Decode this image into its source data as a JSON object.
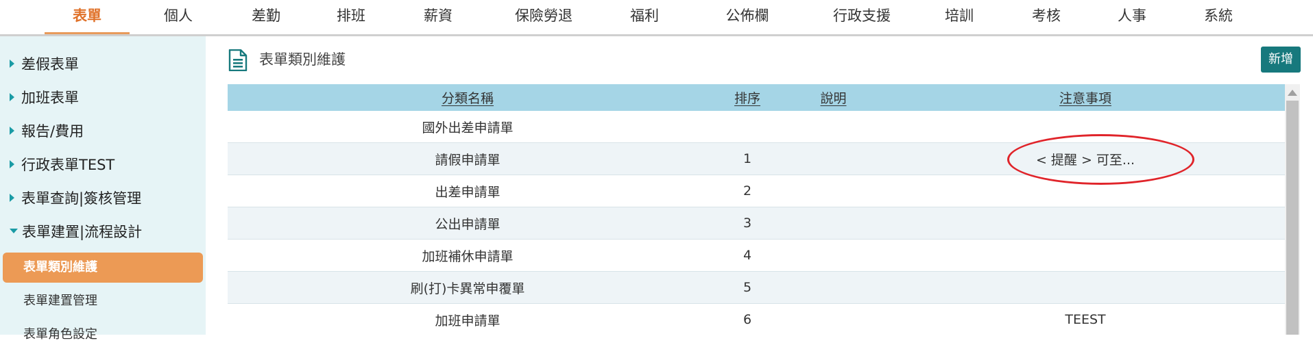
{
  "nav": {
    "items": [
      {
        "label": "表單",
        "active": true
      },
      {
        "label": "個人"
      },
      {
        "label": "差勤"
      },
      {
        "label": "排班"
      },
      {
        "label": "薪資"
      },
      {
        "label": "保險勞退"
      },
      {
        "label": "福利"
      },
      {
        "label": "公佈欄"
      },
      {
        "label": "行政支援"
      },
      {
        "label": "培訓"
      },
      {
        "label": "考核"
      },
      {
        "label": "人事"
      },
      {
        "label": "系統"
      }
    ]
  },
  "sidebar": {
    "sections": [
      {
        "label": "差假表單",
        "expanded": false
      },
      {
        "label": "加班表單",
        "expanded": false
      },
      {
        "label": "報告/費用",
        "expanded": false
      },
      {
        "label": "行政表單TEST",
        "expanded": false
      },
      {
        "label": "表單查詢|簽核管理",
        "expanded": false
      },
      {
        "label": "表單建置|流程設計",
        "expanded": true
      }
    ],
    "subitems": [
      {
        "label": "表單類別維護",
        "active": true
      },
      {
        "label": "表單建置管理"
      },
      {
        "label": "表單角色設定"
      }
    ]
  },
  "page": {
    "title": "表單類別維護",
    "title_icon": "document-icon",
    "add_button": "新增"
  },
  "table": {
    "headers": [
      "分類名稱",
      "排序",
      "說明",
      "注意事項"
    ],
    "rows": [
      {
        "name": "國外出差申請單",
        "order": "",
        "desc": "",
        "notes": ""
      },
      {
        "name": "請假申請單",
        "order": "1",
        "desc": "",
        "notes": "< 提醒 >  可至..."
      },
      {
        "name": "出差申請單",
        "order": "2",
        "desc": "",
        "notes": ""
      },
      {
        "name": "公出申請單",
        "order": "3",
        "desc": "",
        "notes": ""
      },
      {
        "name": "加班補休申請單",
        "order": "4",
        "desc": "",
        "notes": ""
      },
      {
        "name": "刷(打)卡異常申覆單",
        "order": "5",
        "desc": "",
        "notes": ""
      },
      {
        "name": "加班申請單",
        "order": "6",
        "desc": "",
        "notes": "TEEST"
      }
    ]
  },
  "colors": {
    "accent": "#e0722a",
    "active_item_bg": "#ec9a55",
    "sidebar_bg": "#e6f4f6",
    "table_header_bg": "#a5d5e6",
    "button_bg": "#17797d",
    "annotation": "#e0242a"
  }
}
